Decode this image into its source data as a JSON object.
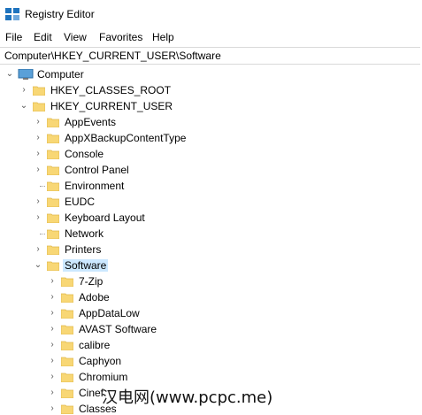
{
  "window": {
    "title": "Registry Editor"
  },
  "menu": [
    "File",
    "Edit",
    "View",
    "Favorites",
    "Help"
  ],
  "address": "Computer\\HKEY_CURRENT_USER\\Software",
  "tree": {
    "root": "Computer",
    "hives": [
      {
        "label": "HKEY_CLASSES_ROOT",
        "expanded": false
      },
      {
        "label": "HKEY_CURRENT_USER",
        "expanded": true
      }
    ],
    "hkcu_children": [
      {
        "label": "AppEvents",
        "expandable": true
      },
      {
        "label": "AppXBackupContentType",
        "expandable": true
      },
      {
        "label": "Console",
        "expandable": true
      },
      {
        "label": "Control Panel",
        "expandable": true
      },
      {
        "label": "Environment",
        "expandable": false
      },
      {
        "label": "EUDC",
        "expandable": true
      },
      {
        "label": "Keyboard Layout",
        "expandable": true
      },
      {
        "label": "Network",
        "expandable": false
      },
      {
        "label": "Printers",
        "expandable": true
      },
      {
        "label": "Software",
        "expandable": true,
        "selected": true
      }
    ],
    "software_children": [
      {
        "label": "7-Zip"
      },
      {
        "label": "Adobe"
      },
      {
        "label": "AppDataLow"
      },
      {
        "label": "AVAST Software"
      },
      {
        "label": "calibre"
      },
      {
        "label": "Caphyon"
      },
      {
        "label": "Chromium"
      },
      {
        "label": "Cinef"
      },
      {
        "label": "Classes"
      }
    ]
  },
  "watermark": "汉电网(www.pcpc.me)",
  "colors": {
    "folder": "#f8d775",
    "folder_edge": "#e0b84a",
    "selection": "#cce8ff",
    "icon_blue": "#1e73be"
  }
}
